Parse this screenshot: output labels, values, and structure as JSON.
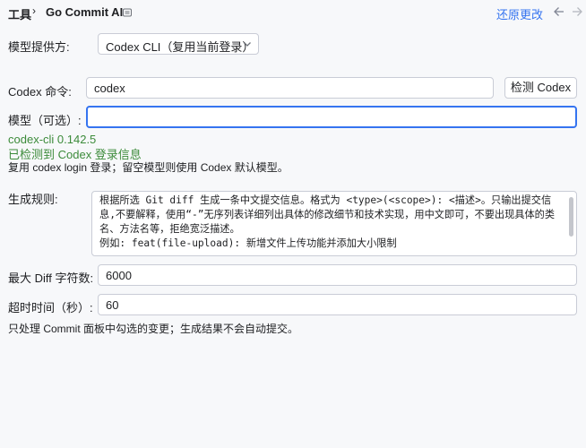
{
  "header": {
    "breadcrumb_parent": "工具",
    "breadcrumb_separator": "›",
    "breadcrumb_current": "Go Commit AI",
    "reset_label": "还原更改",
    "accent_color": "#3574f0"
  },
  "form": {
    "provider": {
      "label": "模型提供方:",
      "selected": "Codex CLI（复用当前登录）"
    },
    "command": {
      "label": "Codex 命令:",
      "value": "codex",
      "detect_button": "检测 Codex"
    },
    "model": {
      "label": "模型（可选）:",
      "value": ""
    },
    "status": {
      "version": "codex-cli 0.142.5",
      "login": "已检测到 Codex 登录信息",
      "hint": "复用 codex login 登录；留空模型则使用 Codex 默认模型。",
      "color": "#3c8b3a"
    },
    "rules": {
      "label": "生成规则:",
      "text": "根据所选 Git diff 生成一条中文提交信息。格式为 <type>(<scope>): <描述>。只输出提交信息,不要解释，使用“-”无序列表详细列出具体的修改细节和技术实现，用中文即可，不要出现具体的类名、方法名等，拒绝宽泛描述。\n例如: feat(file-upload): 新增文件上传功能并添加大小限制"
    },
    "max_diff": {
      "label": "最大 Diff 字符数:",
      "value": "6000"
    },
    "timeout": {
      "label": "超时时间（秒）:",
      "value": "60"
    },
    "footer_hint": "只处理 Commit 面板中勾选的变更；生成结果不会自动提交。"
  }
}
